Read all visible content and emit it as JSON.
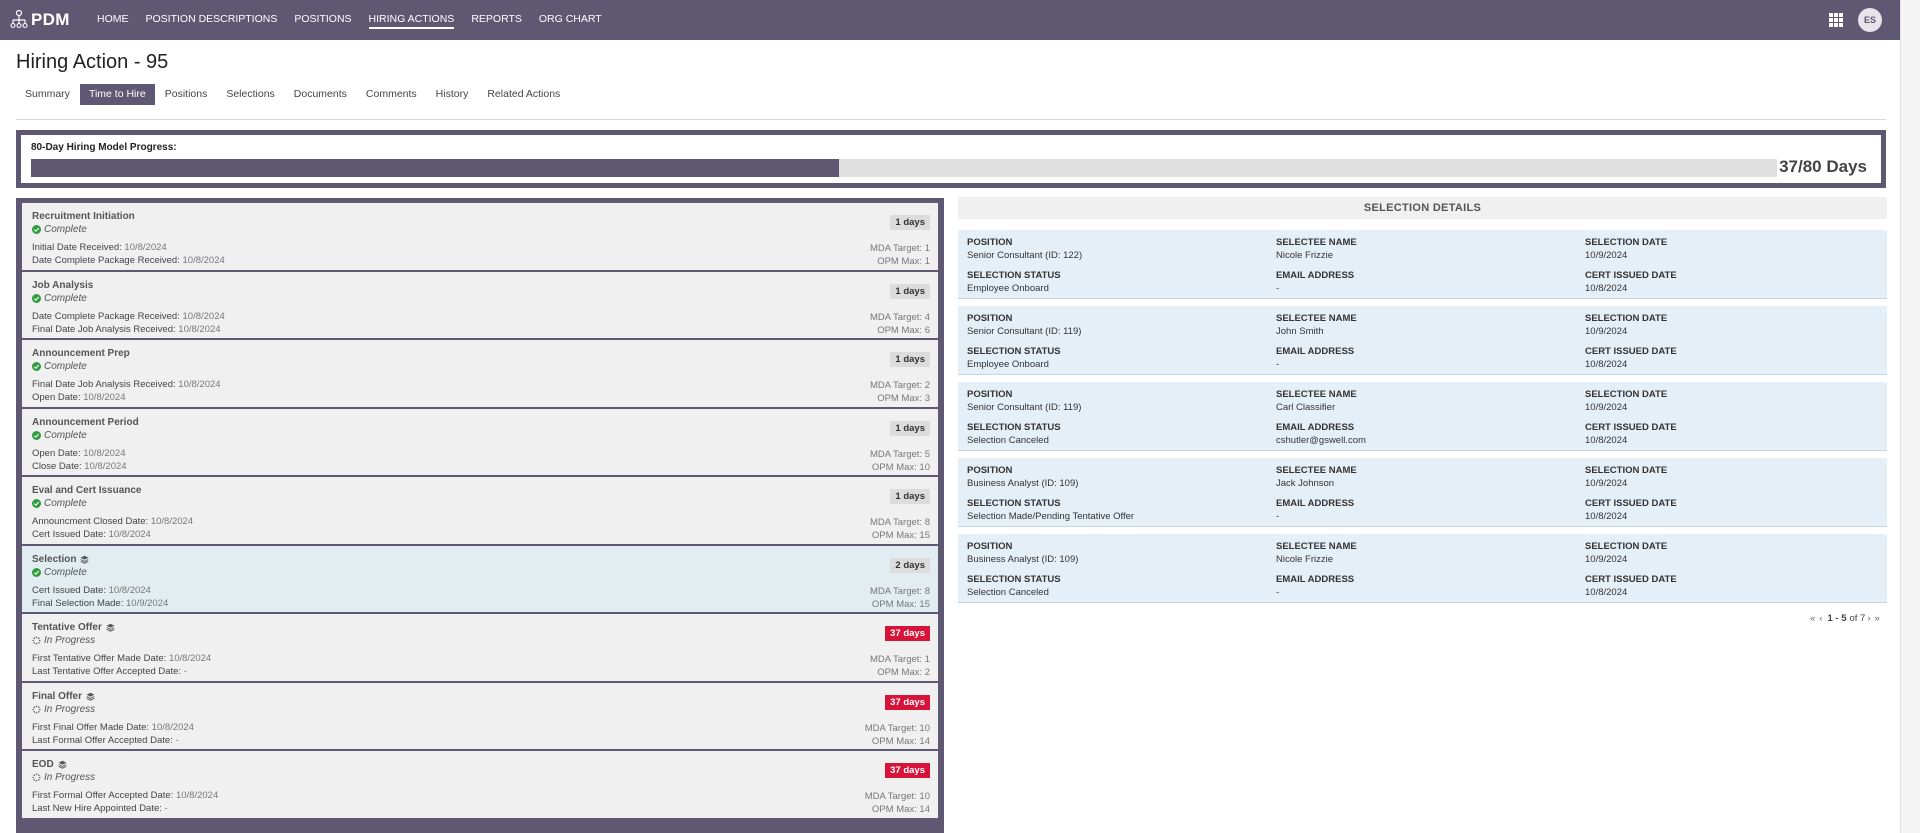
{
  "app": {
    "logo_text": "PDM",
    "nav": [
      {
        "label": "HOME",
        "active": false
      },
      {
        "label": "POSITION DESCRIPTIONS",
        "active": false
      },
      {
        "label": "POSITIONS",
        "active": false
      },
      {
        "label": "HIRING ACTIONS",
        "active": true
      },
      {
        "label": "REPORTS",
        "active": false
      },
      {
        "label": "ORG CHART",
        "active": false
      }
    ],
    "user_initials": "ES",
    "brand_color": "#5f5873"
  },
  "page": {
    "title": "Hiring Action - 95",
    "tabs": [
      {
        "label": "Summary",
        "active": false
      },
      {
        "label": "Time to Hire",
        "active": true
      },
      {
        "label": "Positions",
        "active": false
      },
      {
        "label": "Selections",
        "active": false
      },
      {
        "label": "Documents",
        "active": false
      },
      {
        "label": "Comments",
        "active": false
      },
      {
        "label": "History",
        "active": false
      },
      {
        "label": "Related Actions",
        "active": false
      }
    ]
  },
  "progress": {
    "label": "80-Day Hiring Model Progress:",
    "days_elapsed": 37,
    "days_total": 80,
    "display": "37/80 Days"
  },
  "steps": [
    {
      "title": "Recruitment Initiation",
      "stack_icon": false,
      "status": "Complete",
      "status_icon": "check-circle-icon",
      "days": "1 days",
      "over": false,
      "highlight": false,
      "dates": [
        {
          "label": "Initial Date Received:",
          "value": "10/8/2024"
        },
        {
          "label": "Date Complete Package Received:",
          "value": "10/8/2024"
        }
      ],
      "targets": [
        "MDA Target: 1",
        "OPM Max: 1"
      ]
    },
    {
      "title": "Job Analysis",
      "stack_icon": false,
      "status": "Complete",
      "status_icon": "check-circle-icon",
      "days": "1 days",
      "over": false,
      "highlight": false,
      "dates": [
        {
          "label": "Date Complete Package Received:",
          "value": "10/8/2024"
        },
        {
          "label": "Final Date Job Analysis Received:",
          "value": "10/8/2024"
        }
      ],
      "targets": [
        "MDA Target: 4",
        "OPM Max: 6"
      ]
    },
    {
      "title": "Announcement Prep",
      "stack_icon": false,
      "status": "Complete",
      "status_icon": "check-circle-icon",
      "days": "1 days",
      "over": false,
      "highlight": false,
      "dates": [
        {
          "label": "Final Date Job Analysis Received:",
          "value": "10/8/2024"
        },
        {
          "label": "Open Date:",
          "value": "10/8/2024"
        }
      ],
      "targets": [
        "MDA Target: 2",
        "OPM Max: 3"
      ]
    },
    {
      "title": "Announcement Period",
      "stack_icon": false,
      "status": "Complete",
      "status_icon": "check-circle-icon",
      "days": "1 days",
      "over": false,
      "highlight": false,
      "dates": [
        {
          "label": "Open Date:",
          "value": "10/8/2024"
        },
        {
          "label": "Close Date:",
          "value": "10/8/2024"
        }
      ],
      "targets": [
        "MDA Target: 5",
        "OPM Max: 10"
      ]
    },
    {
      "title": "Eval and Cert Issuance",
      "stack_icon": false,
      "status": "Complete",
      "status_icon": "check-circle-icon",
      "days": "1 days",
      "over": false,
      "highlight": false,
      "dates": [
        {
          "label": "Announcment Closed Date:",
          "value": "10/8/2024"
        },
        {
          "label": "Cert Issued Date:",
          "value": "10/8/2024"
        }
      ],
      "targets": [
        "MDA Target: 8",
        "OPM Max: 15"
      ]
    },
    {
      "title": "Selection",
      "stack_icon": true,
      "status": "Complete",
      "status_icon": "check-circle-icon",
      "days": "2 days",
      "over": false,
      "highlight": true,
      "dates": [
        {
          "label": "Cert Issued Date:",
          "value": "10/8/2024"
        },
        {
          "label": "Final Selection Made:",
          "value": "10/9/2024"
        }
      ],
      "targets": [
        "MDA Target: 8",
        "OPM Max: 15"
      ]
    },
    {
      "title": "Tentative Offer",
      "stack_icon": true,
      "status": "In Progress",
      "status_icon": "spinner-icon",
      "days": "37 days",
      "over": true,
      "highlight": false,
      "dates": [
        {
          "label": "First Tentative Offer Made Date:",
          "value": "10/8/2024"
        },
        {
          "label": "Last Tentative Offer Accepted Date:",
          "value": " -"
        }
      ],
      "targets": [
        "MDA Target: 1",
        "OPM Max: 2"
      ]
    },
    {
      "title": "Final Offer",
      "stack_icon": true,
      "status": "In Progress",
      "status_icon": "spinner-icon",
      "days": "37 days",
      "over": true,
      "highlight": false,
      "dates": [
        {
          "label": "First Final Offer Made Date:",
          "value": "10/8/2024"
        },
        {
          "label": "Last Formal Offer Accepted Date:",
          "value": " -"
        }
      ],
      "targets": [
        "MDA Target: 10",
        "OPM Max: 14"
      ]
    },
    {
      "title": "EOD",
      "stack_icon": true,
      "status": "In Progress",
      "status_icon": "spinner-icon",
      "days": "37 days",
      "over": true,
      "highlight": false,
      "dates": [
        {
          "label": "First Formal Offer Accepted Date:",
          "value": "10/8/2024"
        },
        {
          "label": "Last New Hire Appointed Date:",
          "value": " -"
        }
      ],
      "targets": [
        "MDA Target: 10",
        "OPM Max: 14"
      ]
    }
  ],
  "selection_details": {
    "header": "SELECTION DETAILS",
    "labels": {
      "position": "POSITION",
      "selectee_name": "SELECTEE NAME",
      "selection_date": "SELECTION DATE",
      "selection_status": "SELECTION STATUS",
      "email_address": "EMAIL ADDRESS",
      "cert_issued_date": "CERT ISSUED DATE"
    },
    "cards": [
      {
        "position": "Senior Consultant (ID: 122)",
        "selectee_name": "Nicole Frizzie",
        "selection_date": "10/9/2024",
        "selection_status": "Employee Onboard",
        "email_address": "-",
        "cert_issued_date": "10/8/2024"
      },
      {
        "position": "Senior Consultant (ID: 119)",
        "selectee_name": "John Smith",
        "selection_date": "10/9/2024",
        "selection_status": "Employee Onboard",
        "email_address": "-",
        "cert_issued_date": "10/8/2024"
      },
      {
        "position": "Senior Consultant (ID: 119)",
        "selectee_name": "Carl Classifier",
        "selection_date": "10/9/2024",
        "selection_status": "Selection Canceled",
        "email_address": "cshutler@gswell.com",
        "cert_issued_date": "10/8/2024"
      },
      {
        "position": "Business Analyst (ID: 109)",
        "selectee_name": "Jack Johnson",
        "selection_date": "10/9/2024",
        "selection_status": "Selection Made/Pending Tentative Offer",
        "email_address": "-",
        "cert_issued_date": "10/8/2024"
      },
      {
        "position": "Business Analyst (ID: 109)",
        "selectee_name": "Nicole Frizzie",
        "selection_date": "10/9/2024",
        "selection_status": "Selection Canceled",
        "email_address": "-",
        "cert_issued_date": "10/8/2024"
      }
    ],
    "pager": {
      "first": "«",
      "prev": "‹",
      "range": "1 - 5",
      "of_text": "of 7",
      "next": "›",
      "last": "»"
    }
  }
}
